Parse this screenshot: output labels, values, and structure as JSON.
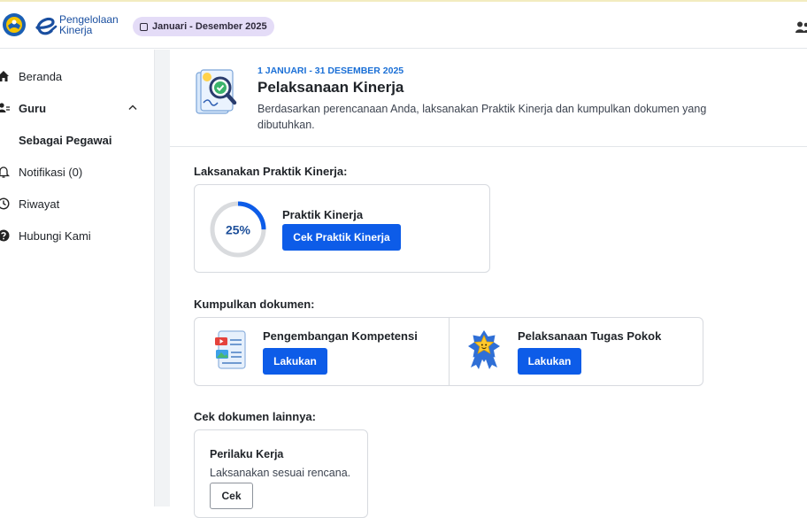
{
  "header": {
    "logo_line1": "Pengelolaan",
    "logo_line2": "Kinerja",
    "period_chip": "Januari - Desember 2025"
  },
  "sidebar": {
    "items": [
      {
        "label": "Beranda",
        "icon": "home-icon"
      },
      {
        "label": "Guru",
        "icon": "users-icon"
      },
      {
        "label": "Sebagai Pegawai",
        "icon": ""
      },
      {
        "label": "Notifikasi (0)",
        "icon": "bell-icon"
      },
      {
        "label": "Riwayat",
        "icon": "clock-icon"
      },
      {
        "label": "Hubungi Kami",
        "icon": "help-icon"
      }
    ]
  },
  "page": {
    "date_range": "1 JANUARI - 31 DESEMBER 2025",
    "title": "Pelaksanaan Kinerja",
    "description": "Berdasarkan perencanaan Anda, laksanakan Praktik Kinerja dan kumpulkan dokumen yang dibutuhkan."
  },
  "practice": {
    "section_title": "Laksanakan Praktik Kinerja:",
    "progress_label": "25%",
    "progress_fraction": 0.25,
    "card_title": "Praktik Kinerja",
    "button_label": "Cek Praktik Kinerja"
  },
  "documents": {
    "section_title": "Kumpulkan dokumen:",
    "items": [
      {
        "title": "Pengembangan Kompetensi",
        "button_label": "Lakukan",
        "icon": "document-media-icon"
      },
      {
        "title": "Pelaksanaan Tugas Pokok",
        "button_label": "Lakukan",
        "icon": "star-medal-icon"
      }
    ]
  },
  "other": {
    "section_title": "Cek dokumen lainnya:",
    "card_title": "Perilaku Kerja",
    "card_desc": "Laksanakan sesuai rencana.",
    "button_label": "Cek"
  },
  "colors": {
    "primary": "#0d5ce8",
    "accent_text": "#1a6fd6",
    "chip_bg": "#e4dcf7",
    "progress_track": "#d9dbde"
  }
}
